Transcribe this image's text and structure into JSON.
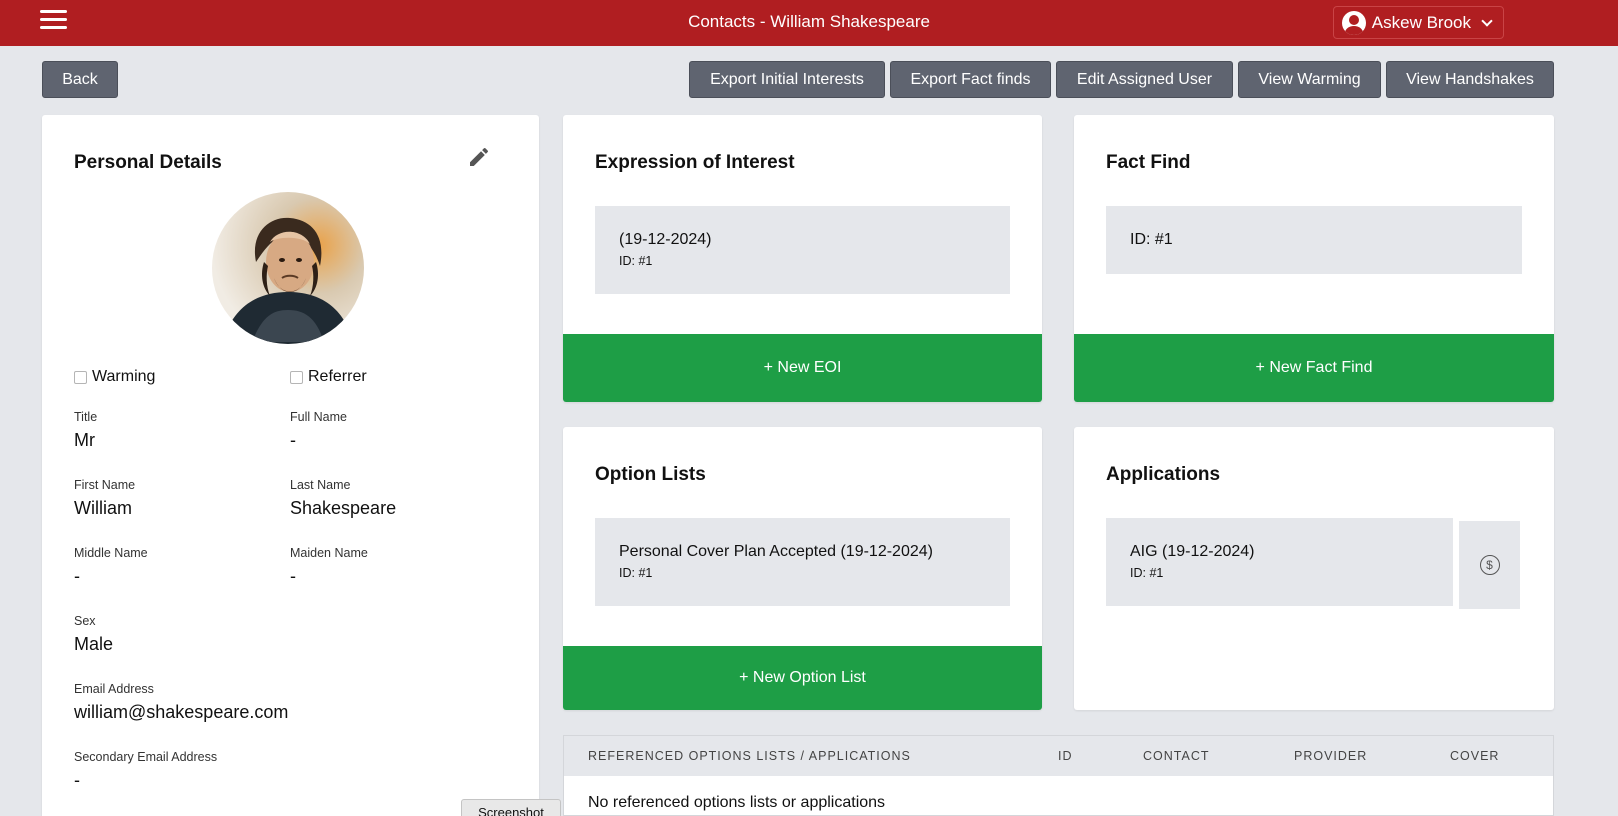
{
  "header": {
    "title": "Contacts - William Shakespeare",
    "user_name": "Askew Brook"
  },
  "toolbar": {
    "back": "Back",
    "export_initial_interests": "Export Initial Interests",
    "export_fact_finds": "Export Fact finds",
    "edit_assigned_user": "Edit Assigned User",
    "view_warming": "View Warming",
    "view_handshakes": "View Handshakes"
  },
  "personal_details": {
    "title": "Personal Details",
    "warming_label": "Warming",
    "referrer_label": "Referrer",
    "title_label": "Title",
    "title_value": "Mr",
    "full_name_label": "Full Name",
    "full_name_value": "-",
    "first_name_label": "First Name",
    "first_name_value": "William",
    "last_name_label": "Last Name",
    "last_name_value": "Shakespeare",
    "middle_name_label": "Middle Name",
    "middle_name_value": "-",
    "maiden_name_label": "Maiden Name",
    "maiden_name_value": "-",
    "sex_label": "Sex",
    "sex_value": "Male",
    "email_label": "Email Address",
    "email_value": "william@shakespeare.com",
    "secondary_email_label": "Secondary Email Address",
    "secondary_email_value": "-"
  },
  "eoi": {
    "title": "Expression of Interest",
    "item_title": "(19-12-2024)",
    "item_id": "ID: #1",
    "new_button": "+ New EOI"
  },
  "fact_find": {
    "title": "Fact Find",
    "item_id": "ID: #1",
    "new_button": "+ New Fact Find"
  },
  "option_lists": {
    "title": "Option Lists",
    "item_title": "Personal Cover Plan Accepted (19-12-2024)",
    "item_id": "ID: #1",
    "new_button": "+ New Option List"
  },
  "applications": {
    "title": "Applications",
    "item_title": "AIG (19-12-2024)",
    "item_id": "ID: #1",
    "action_icon_glyph": "$"
  },
  "referenced_table": {
    "columns": [
      "REFERENCED OPTIONS LISTS / APPLICATIONS",
      "ID",
      "CONTACT",
      "PROVIDER",
      "COVER"
    ],
    "empty_message": "No referenced options lists or applications"
  },
  "screenshot_tab": "Screenshot",
  "colors": {
    "header_red": "#b01e21",
    "button_gray": "#5f6470",
    "action_green": "#1e9e46",
    "page_bg": "#e5e7eb"
  }
}
